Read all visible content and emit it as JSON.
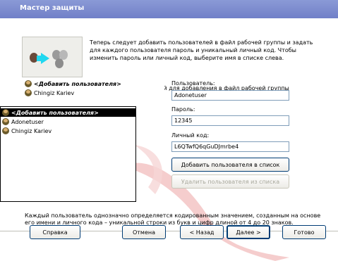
{
  "window": {
    "title": "Мастер защиты"
  },
  "intro": {
    "text": "Теперь следует добавить пользователей в файл рабочей группы и задать для каждого пользователя пароль и уникальный личный код. Чтобы изменить пароль или личный код, выберите имя в списке слева."
  },
  "prompt": "Укажите пользователей для добавления в файл рабочей группы",
  "user_list": {
    "items": [
      "<Добавить пользователя>",
      "Chingiz Kariev"
    ]
  },
  "dropdown": {
    "items": [
      "<Добавить пользователя>",
      "Adonetuser",
      "Chingiz Kariev"
    ],
    "selected_index": 0
  },
  "form": {
    "user_label": "Пользователь:",
    "user_value": "Adonetuser",
    "password_label": "Пароль:",
    "password_value": "12345",
    "pid_label": "Личный код:",
    "pid_value": "L6QTwfQ6qGuDJmrbe4"
  },
  "buttons": {
    "add": "Добавить пользователя в список",
    "remove": "Удалить пользователя из списка",
    "help": "Справка",
    "cancel": "Отмена",
    "back": "< Назад",
    "next": "Далее >",
    "finish": "Готово"
  },
  "footnote": "Каждый пользователь однозначно определяется кодированным значением, созданным на основе его имени и личного кода – уникальной строки из букв и цифр длиной от 4 до 20 знаков.",
  "colors": {
    "titlebar": "#7a88cc",
    "selection": "#000000",
    "dialog_bg": "#ece9d8"
  }
}
